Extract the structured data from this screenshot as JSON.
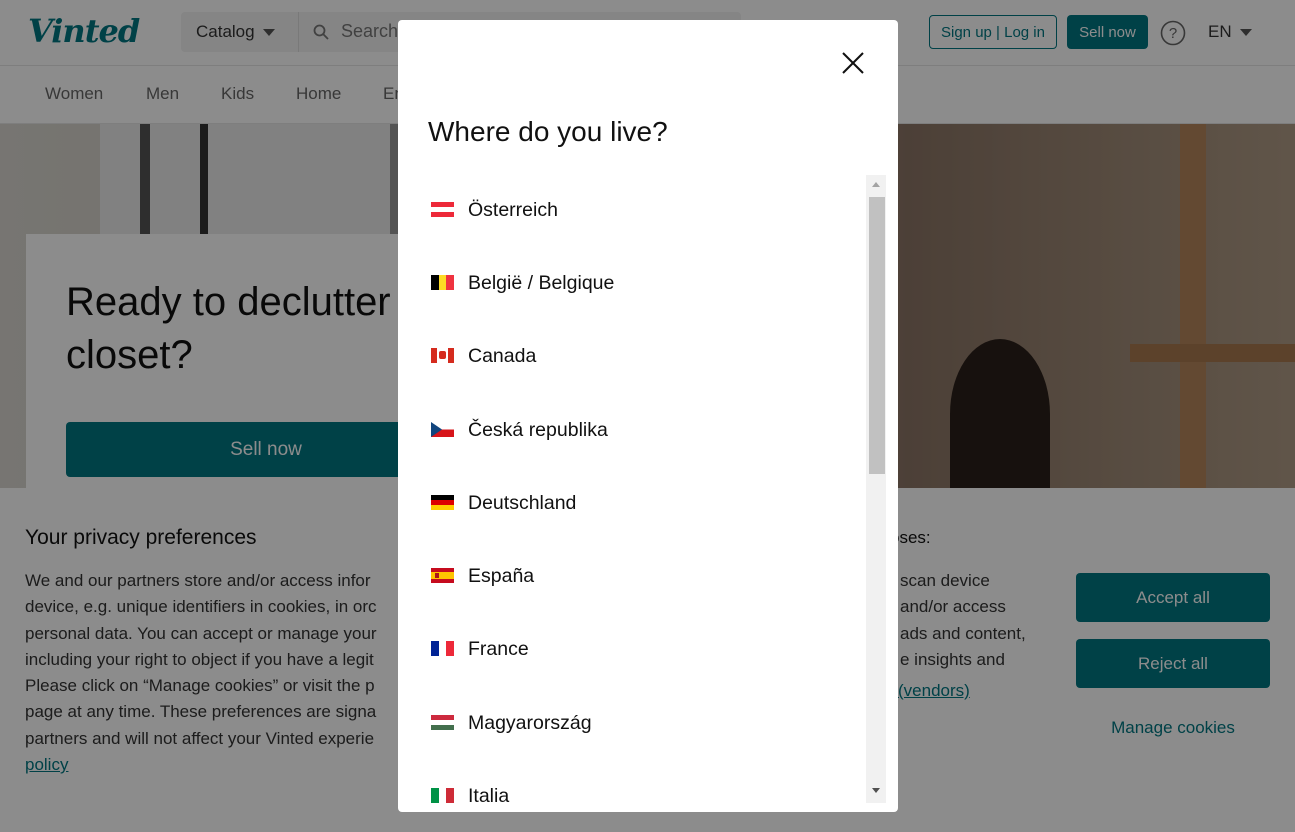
{
  "header": {
    "logo": "Vinted",
    "catalog_label": "Catalog",
    "search_placeholder": "Search",
    "auth_label": "Sign up | Log in",
    "sell_label": "Sell now",
    "language": "EN"
  },
  "categories": [
    "Women",
    "Men",
    "Kids",
    "Home",
    "En"
  ],
  "hero": {
    "headline": "Ready to declutter your closet?",
    "cta": "Sell now"
  },
  "privacy": {
    "title": "Your privacy preferences",
    "text": "We and our partners store and/or access infor\ndevice, e.g. unique identifiers in cookies, in orc\npersonal data. You can accept or manage your\nincluding your right to object if you have a legit\nPlease click on “Manage cookies” or visit the p\npage at any time. These preferences are signa\npartners and will not affect your Vinted experie",
    "policy_link": "policy",
    "right_heading": "oses:",
    "right_text": "scan device\nand/or access\nads and content,\ne insights and",
    "vendors_link": "(vendors)",
    "accept_label": "Accept all",
    "reject_label": "Reject all",
    "manage_label": "Manage cookies"
  },
  "modal": {
    "title": "Where do you live?",
    "countries": [
      {
        "name": "Österreich",
        "flag": "austria-flag"
      },
      {
        "name": "België / Belgique",
        "flag": "belgium-flag"
      },
      {
        "name": "Canada",
        "flag": "canada-flag"
      },
      {
        "name": "Česká republika",
        "flag": "czech-flag"
      },
      {
        "name": "Deutschland",
        "flag": "germany-flag"
      },
      {
        "name": "España",
        "flag": "spain-flag"
      },
      {
        "name": "France",
        "flag": "france-flag"
      },
      {
        "name": "Magyarország",
        "flag": "hungary-flag"
      },
      {
        "name": "Italia",
        "flag": "italy-flag"
      }
    ]
  },
  "colors": {
    "brand": "#007782",
    "overlay": "rgba(0,0,0,0.45)"
  }
}
